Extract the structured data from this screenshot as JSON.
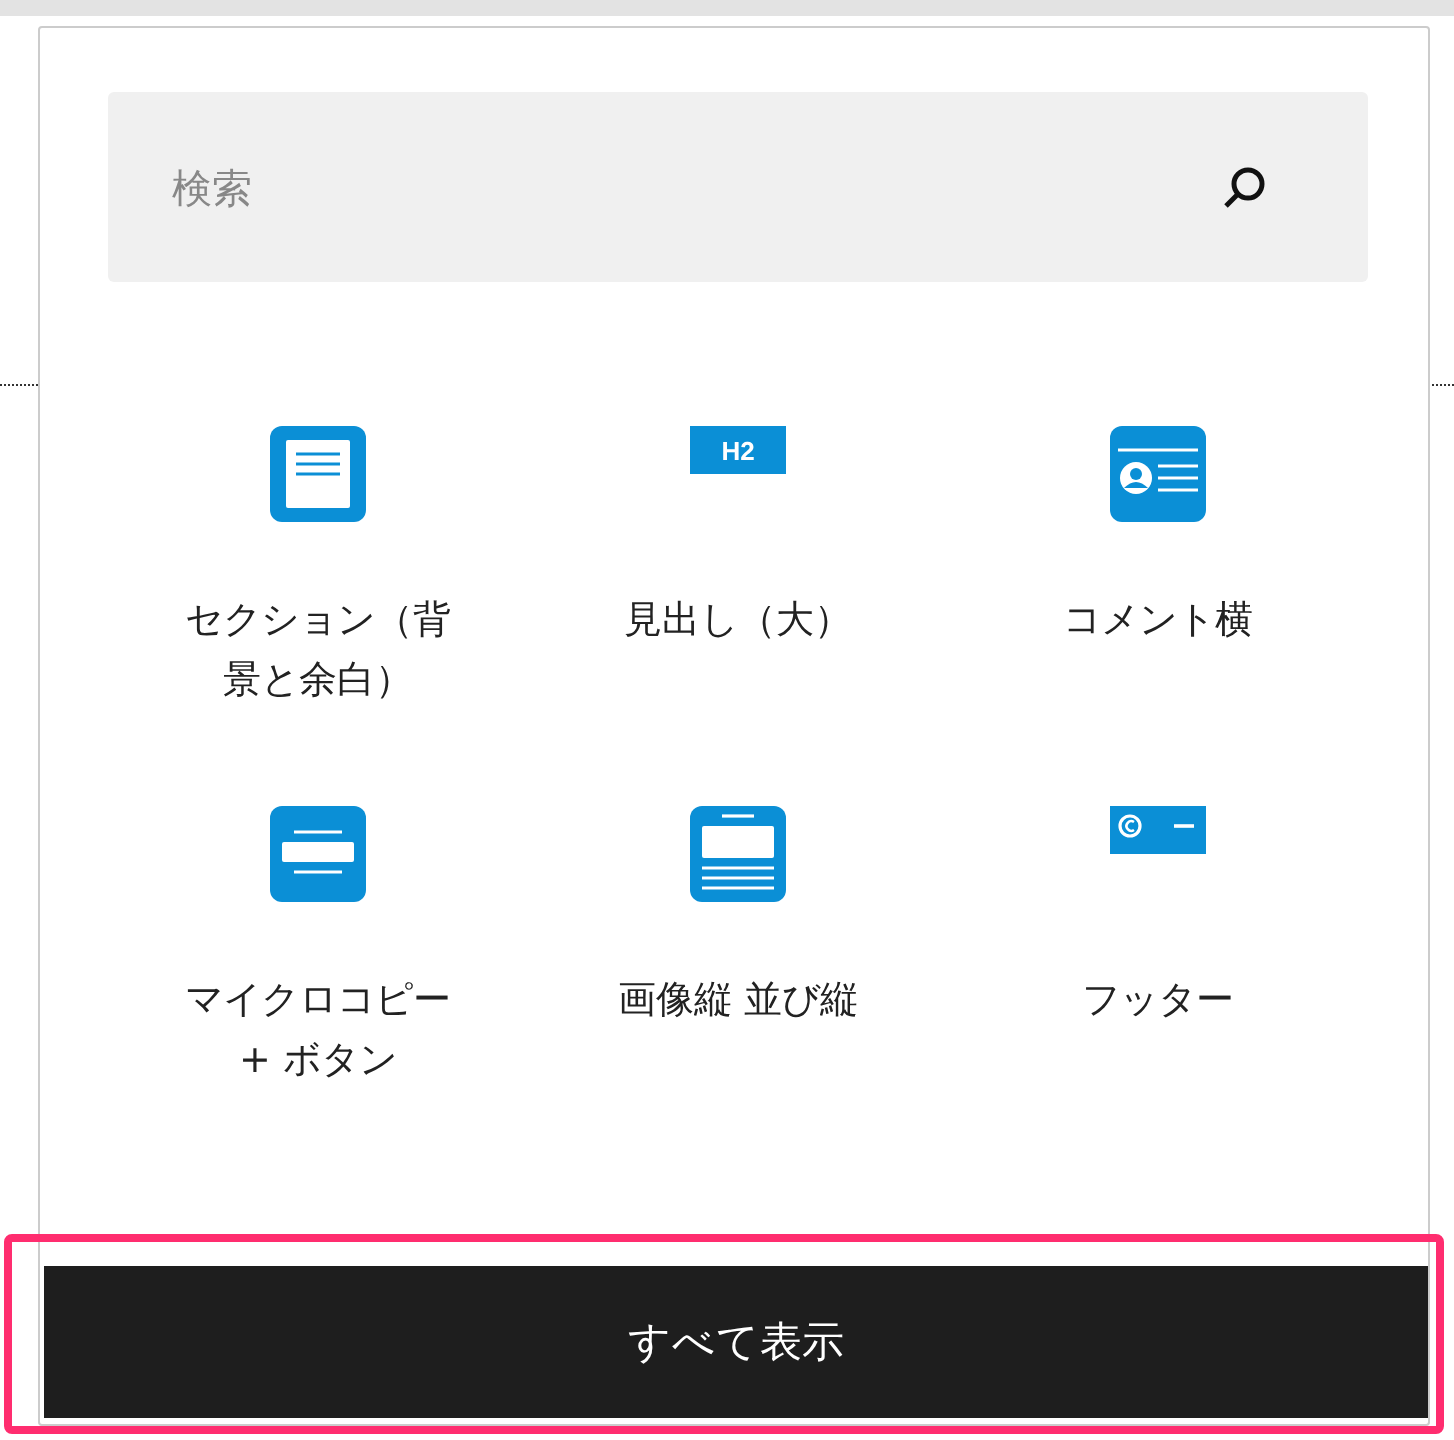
{
  "search": {
    "placeholder": "検索"
  },
  "blocks": [
    {
      "label": "セクション（背景と余白）",
      "kind": "section"
    },
    {
      "label": "見出し（大）",
      "kind": "heading",
      "badge_text": "H2"
    },
    {
      "label": "コメント横",
      "kind": "comment"
    },
    {
      "label": "マイクロコピー + ボタン",
      "kind": "microcopy"
    },
    {
      "label": "画像縦 並び縦",
      "kind": "image"
    },
    {
      "label": "フッター",
      "kind": "footer"
    }
  ],
  "show_all_button": {
    "label": "すべて表示",
    "highlighted": true
  }
}
